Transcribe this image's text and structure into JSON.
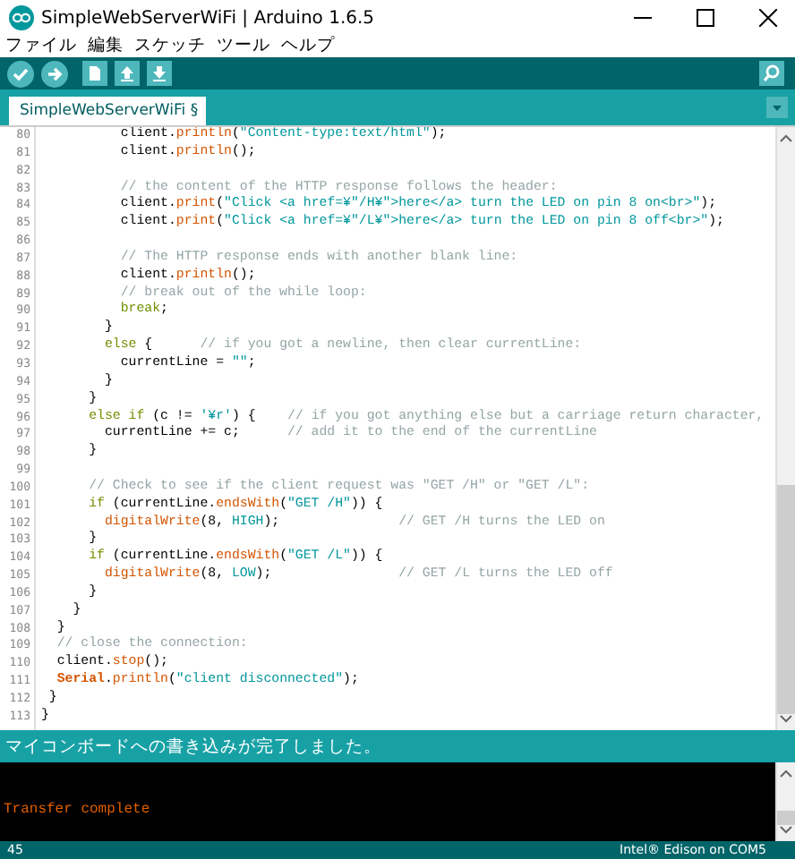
{
  "window": {
    "title": "SimpleWebServerWiFi | Arduino 1.6.5"
  },
  "menu": [
    "ファイル",
    "編集",
    "スケッチ",
    "ツール",
    "ヘルプ"
  ],
  "tabs": [
    {
      "label": "SimpleWebServerWiFi §",
      "selected": true
    }
  ],
  "editor": {
    "lines": [
      {
        "n": "80",
        "code": [
          {
            "kind": "plain",
            "text": "          client."
          },
          {
            "kind": "fn",
            "text": "println"
          },
          {
            "kind": "plain",
            "text": "("
          },
          {
            "kind": "str",
            "text": "\"Content-type:text/html\""
          },
          {
            "kind": "plain",
            "text": ");"
          }
        ]
      },
      {
        "n": "81",
        "code": [
          {
            "kind": "plain",
            "text": "          client."
          },
          {
            "kind": "fn",
            "text": "println"
          },
          {
            "kind": "plain",
            "text": "();"
          }
        ]
      },
      {
        "n": "82"
      },
      {
        "n": "83",
        "code": [
          {
            "kind": "comment",
            "text": "          // the content of the HTTP response follows the header:"
          }
        ]
      },
      {
        "n": "84",
        "code": [
          {
            "kind": "plain",
            "text": "          client."
          },
          {
            "kind": "fn",
            "text": "print"
          },
          {
            "kind": "plain",
            "text": "("
          },
          {
            "kind": "str",
            "text": "\"Click <a href=¥\"/H¥\">here</a> turn the LED on pin 8 on<br>\""
          },
          {
            "kind": "plain",
            "text": ");"
          }
        ]
      },
      {
        "n": "85",
        "code": [
          {
            "kind": "plain",
            "text": "          client."
          },
          {
            "kind": "fn",
            "text": "print"
          },
          {
            "kind": "plain",
            "text": "("
          },
          {
            "kind": "str",
            "text": "\"Click <a href=¥\"/L¥\">here</a> turn the LED on pin 8 off<br>\""
          },
          {
            "kind": "plain",
            "text": ");"
          }
        ]
      },
      {
        "n": "86"
      },
      {
        "n": "87",
        "code": [
          {
            "kind": "comment",
            "text": "          // The HTTP response ends with another blank line:"
          }
        ]
      },
      {
        "n": "88",
        "code": [
          {
            "kind": "plain",
            "text": "          client."
          },
          {
            "kind": "fn",
            "text": "println"
          },
          {
            "kind": "plain",
            "text": "();"
          }
        ]
      },
      {
        "n": "89",
        "code": [
          {
            "kind": "comment",
            "text": "          // break out of the while loop:"
          }
        ]
      },
      {
        "n": "90",
        "code": [
          {
            "kind": "kw",
            "text": "          break"
          },
          {
            "kind": "plain",
            "text": ";"
          }
        ]
      },
      {
        "n": "91",
        "code": [
          {
            "kind": "plain",
            "text": "        }"
          }
        ]
      },
      {
        "n": "92",
        "code": [
          {
            "kind": "kw",
            "text": "        else"
          },
          {
            "kind": "plain",
            "text": " {      "
          },
          {
            "kind": "comment",
            "text": "// if you got a newline, then clear currentLine:"
          }
        ]
      },
      {
        "n": "93",
        "code": [
          {
            "kind": "plain",
            "text": "          currentLine = "
          },
          {
            "kind": "str",
            "text": "\"\""
          },
          {
            "kind": "plain",
            "text": ";"
          }
        ]
      },
      {
        "n": "94",
        "code": [
          {
            "kind": "plain",
            "text": "        }"
          }
        ]
      },
      {
        "n": "95",
        "code": [
          {
            "kind": "plain",
            "text": "      }"
          }
        ]
      },
      {
        "n": "96",
        "code": [
          {
            "kind": "kw",
            "text": "      else if"
          },
          {
            "kind": "plain",
            "text": " (c != "
          },
          {
            "kind": "str",
            "text": "'¥r'"
          },
          {
            "kind": "plain",
            "text": ") {    "
          },
          {
            "kind": "comment",
            "text": "// if you got anything else but a carriage return character,"
          }
        ]
      },
      {
        "n": "97",
        "code": [
          {
            "kind": "plain",
            "text": "        currentLine += c;      "
          },
          {
            "kind": "comment",
            "text": "// add it to the end of the currentLine"
          }
        ]
      },
      {
        "n": "98",
        "code": [
          {
            "kind": "plain",
            "text": "      }"
          }
        ]
      },
      {
        "n": "99"
      },
      {
        "n": "100",
        "code": [
          {
            "kind": "comment",
            "text": "      // Check to see if the client request was \"GET /H\" or \"GET /L\":"
          }
        ]
      },
      {
        "n": "101",
        "code": [
          {
            "kind": "kw",
            "text": "      if"
          },
          {
            "kind": "plain",
            "text": " (currentLine."
          },
          {
            "kind": "fn",
            "text": "endsWith"
          },
          {
            "kind": "plain",
            "text": "("
          },
          {
            "kind": "str",
            "text": "\"GET /H\""
          },
          {
            "kind": "plain",
            "text": ")) {"
          }
        ]
      },
      {
        "n": "102",
        "code": [
          {
            "kind": "fn",
            "text": "        digitalWrite"
          },
          {
            "kind": "plain",
            "text": "(8, "
          },
          {
            "kind": "const",
            "text": "HIGH"
          },
          {
            "kind": "plain",
            "text": ");               "
          },
          {
            "kind": "comment",
            "text": "// GET /H turns the LED on"
          }
        ]
      },
      {
        "n": "103",
        "code": [
          {
            "kind": "plain",
            "text": "      }"
          }
        ]
      },
      {
        "n": "104",
        "code": [
          {
            "kind": "kw",
            "text": "      if"
          },
          {
            "kind": "plain",
            "text": " (currentLine."
          },
          {
            "kind": "fn",
            "text": "endsWith"
          },
          {
            "kind": "plain",
            "text": "("
          },
          {
            "kind": "str",
            "text": "\"GET /L\""
          },
          {
            "kind": "plain",
            "text": ")) {"
          }
        ]
      },
      {
        "n": "105",
        "code": [
          {
            "kind": "fn",
            "text": "        digitalWrite"
          },
          {
            "kind": "plain",
            "text": "(8, "
          },
          {
            "kind": "const",
            "text": "LOW"
          },
          {
            "kind": "plain",
            "text": ");                "
          },
          {
            "kind": "comment",
            "text": "// GET /L turns the LED off"
          }
        ]
      },
      {
        "n": "106",
        "code": [
          {
            "kind": "plain",
            "text": "      }"
          }
        ]
      },
      {
        "n": "107",
        "code": [
          {
            "kind": "plain",
            "text": "    }"
          }
        ]
      },
      {
        "n": "108",
        "code": [
          {
            "kind": "plain",
            "text": "  }"
          }
        ]
      },
      {
        "n": "109",
        "code": [
          {
            "kind": "comment",
            "text": "  // close the connection:"
          }
        ]
      },
      {
        "n": "110",
        "code": [
          {
            "kind": "plain",
            "text": "  client."
          },
          {
            "kind": "fn",
            "text": "stop"
          },
          {
            "kind": "plain",
            "text": "();"
          }
        ]
      },
      {
        "n": "111",
        "code": [
          {
            "kind": "cls",
            "text": "  Serial"
          },
          {
            "kind": "plain",
            "text": "."
          },
          {
            "kind": "fn",
            "text": "println"
          },
          {
            "kind": "plain",
            "text": "("
          },
          {
            "kind": "str",
            "text": "\"client disconnected\""
          },
          {
            "kind": "plain",
            "text": ");"
          }
        ]
      },
      {
        "n": "112",
        "code": [
          {
            "kind": "plain",
            "text": " }"
          }
        ]
      },
      {
        "n": "113",
        "code": [
          {
            "kind": "plain",
            "text": "}"
          }
        ]
      }
    ]
  },
  "status_message": "マイコンボードへの書き込みが完了しました。",
  "console": {
    "lines": [
      "Transfer complete"
    ]
  },
  "status_bar": {
    "line": "45",
    "board": "Intel® Edison on COM5"
  }
}
